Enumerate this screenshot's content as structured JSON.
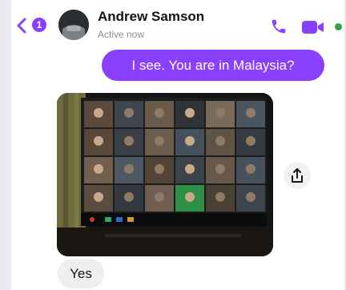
{
  "header": {
    "back_badge": "1",
    "contact_name": "Andrew Samson",
    "status": "Active now"
  },
  "messages": {
    "outgoing_text": "I see. You are in Malaysia?",
    "incoming_text": "Yes"
  },
  "colors": {
    "accent": "#8a3ffc",
    "online": "#31a24c"
  },
  "icons": {
    "back": "chevron-left-icon",
    "phone": "phone-icon",
    "video": "video-camera-icon",
    "share": "share-icon"
  }
}
